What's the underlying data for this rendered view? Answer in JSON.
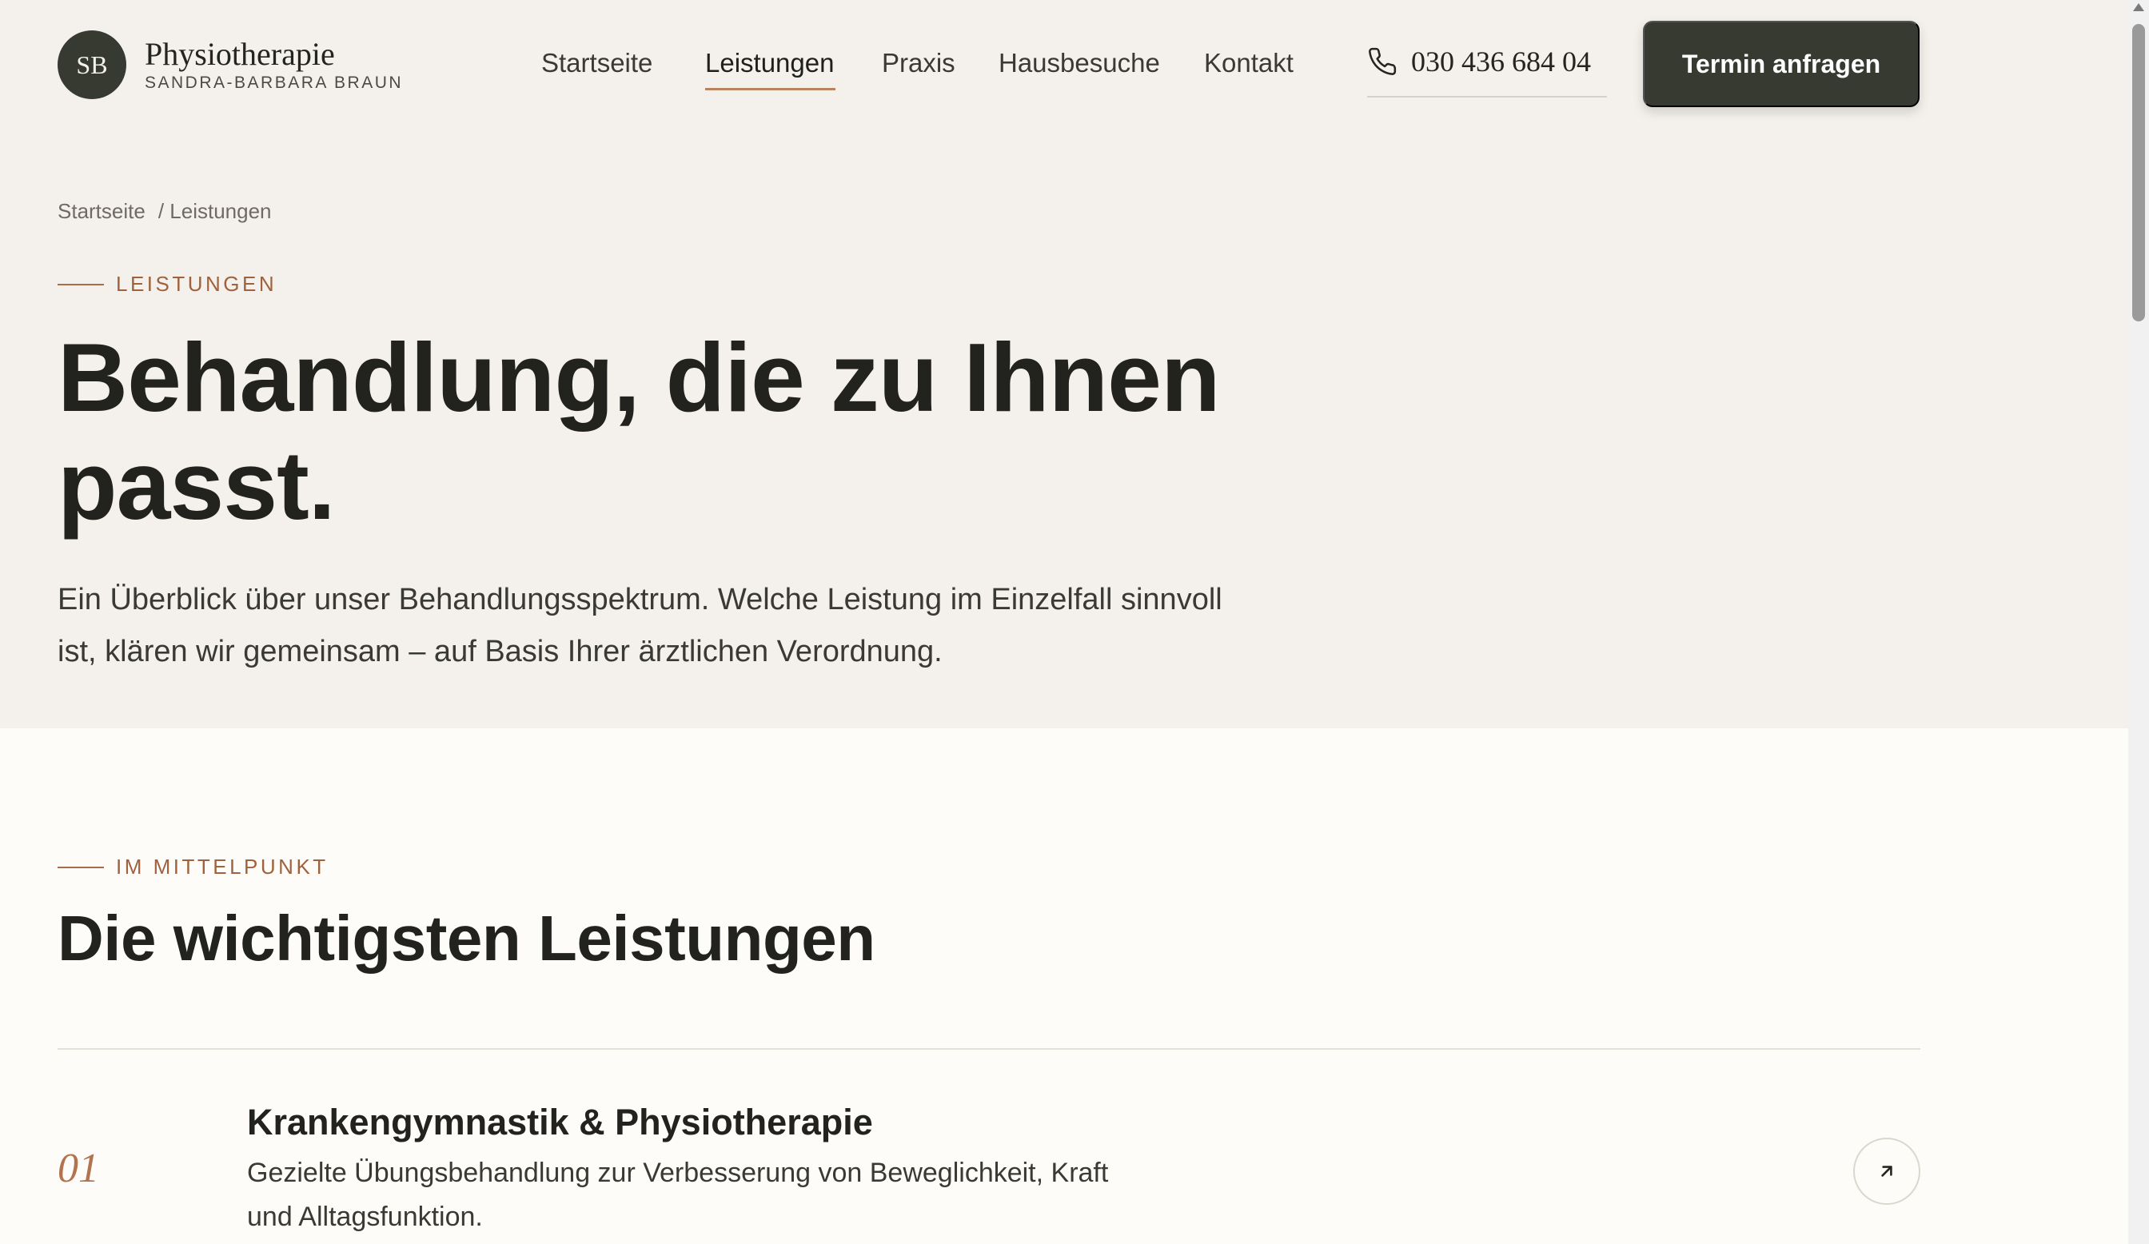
{
  "brand": {
    "initials": "SB",
    "name": "Physiotherapie",
    "subtitle": "SANDRA-BARBARA BRAUN"
  },
  "nav": {
    "items": [
      {
        "label": "Startseite",
        "active": false
      },
      {
        "label": "Leistungen",
        "active": true
      },
      {
        "label": "Praxis",
        "active": false
      },
      {
        "label": "Hausbesuche",
        "active": false
      },
      {
        "label": "Kontakt",
        "active": false
      }
    ]
  },
  "phone": {
    "number": "030 436 684 04",
    "icon": "phone-icon"
  },
  "cta": {
    "label": "Termin anfragen"
  },
  "breadcrumb": {
    "home": "Startseite",
    "current": "/ Leistungen"
  },
  "hero": {
    "eyebrow": "LEISTUNGEN",
    "title_line1": "Behandlung, die zu Ihnen",
    "title_line2": "passt.",
    "text": "Ein Überblick über unser Behandlungsspektrum. Welche Leistung im Einzelfall sinnvoll ist, klären wir gemeinsam – auf Basis Ihrer ärztlichen Verordnung."
  },
  "featured": {
    "eyebrow": "IM MITTELPUNKT",
    "title": "Die wichtigsten Leistungen",
    "services": [
      {
        "number": "01",
        "title": "Krankengymnastik & Physiotherapie",
        "description": "Gezielte Übungsbehandlung zur Verbesserung von Beweglichkeit, Kraft und Alltagsfunktion.",
        "icon": "arrow-up-right-icon"
      }
    ]
  },
  "colors": {
    "hero_bg": "#f4f0eb",
    "page_bg": "#fdfcf9",
    "dark": "#363a31",
    "accent": "#a0623d"
  }
}
